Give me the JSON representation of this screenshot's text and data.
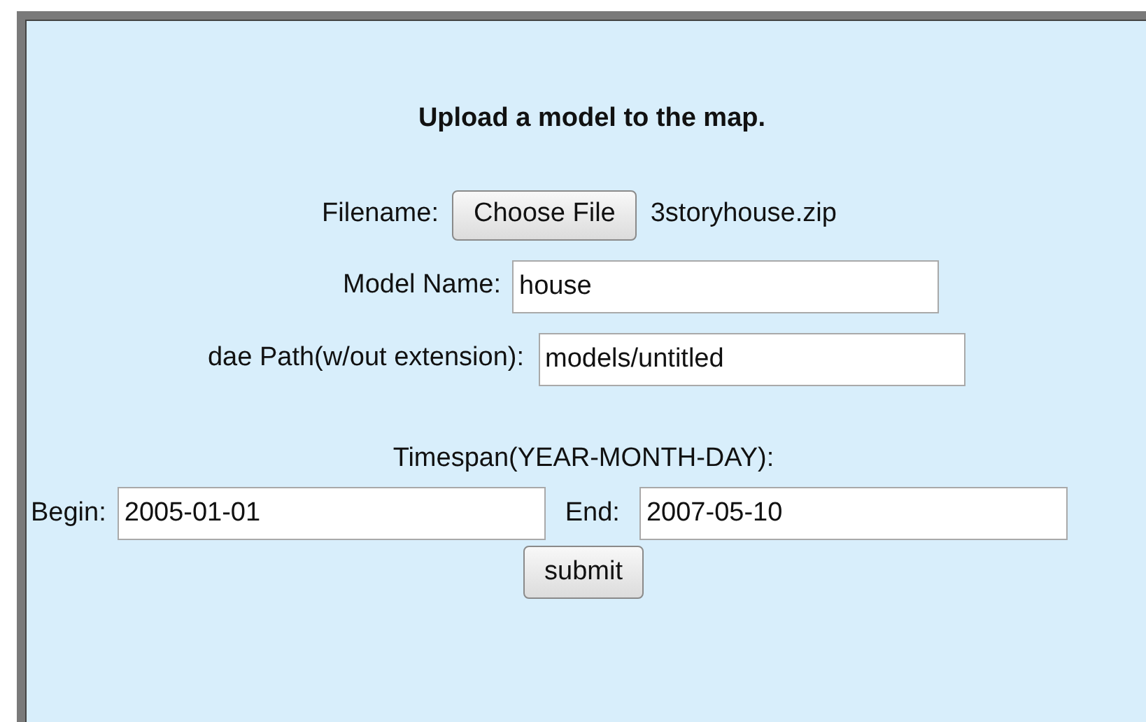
{
  "title": "Upload a model to the map.",
  "file": {
    "label": "Filename:",
    "button": "Choose File",
    "filename": "3storyhouse.zip"
  },
  "model_name": {
    "label": "Model Name:",
    "value": "house"
  },
  "dae_path": {
    "label": "dae Path(w/out extension):",
    "value": "models/untitled"
  },
  "timespan": {
    "label": "Timespan(YEAR-MONTH-DAY):",
    "begin": {
      "label": "Begin:",
      "value": "2005-01-01"
    },
    "end": {
      "label": "End:",
      "value": "2007-05-10"
    }
  },
  "submit": "submit"
}
